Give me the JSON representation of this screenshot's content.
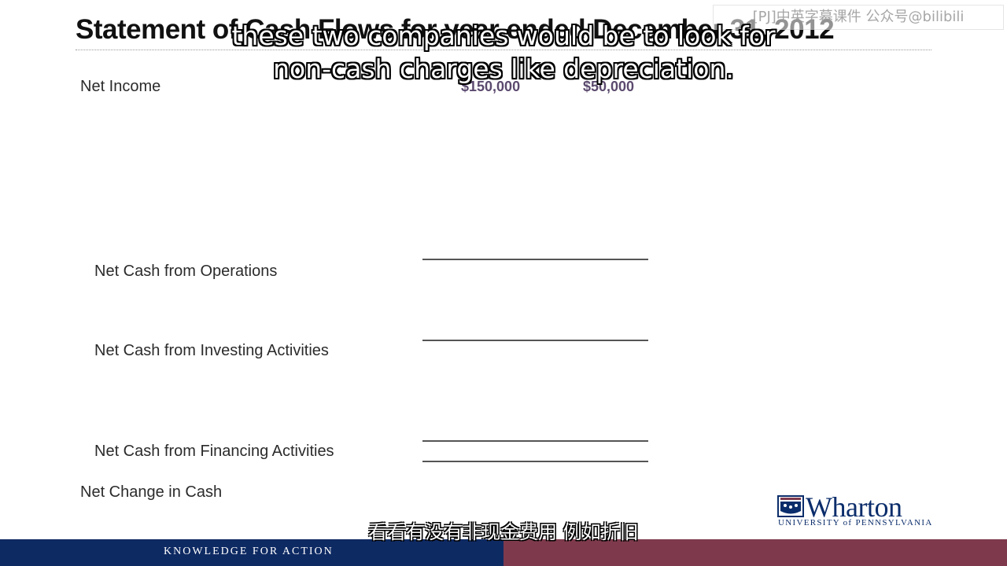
{
  "slide": {
    "title": "Statement of Cash Flows for year ended December 31, 2012",
    "rows": {
      "net_income_label": "Net Income",
      "net_income_values": [
        "$150,000",
        "$50,000"
      ],
      "operations_label": "Net Cash from Operations",
      "investing_label": "Net Cash from Investing Activities",
      "financing_label": "Net Cash from Financing Activities",
      "net_change_label": "Net Change in Cash"
    }
  },
  "subtitles": {
    "english_line1": "these two companies would be to look for",
    "english_line2": "non-cash charges like depreciation.",
    "chinese": "看看有没有非现金费用 例如折旧"
  },
  "watermark": "[PJ]中英字幕课件 公众号@bilibili",
  "branding": {
    "name": "Wharton",
    "university": "UNIVERSITY of PENNSYLVANIA",
    "tagline": "KNOWLEDGE FOR ACTION",
    "colors": {
      "navy": "#0e2a63",
      "maroon": "#7e3a4c",
      "value_purple": "#5b4a6e"
    }
  }
}
